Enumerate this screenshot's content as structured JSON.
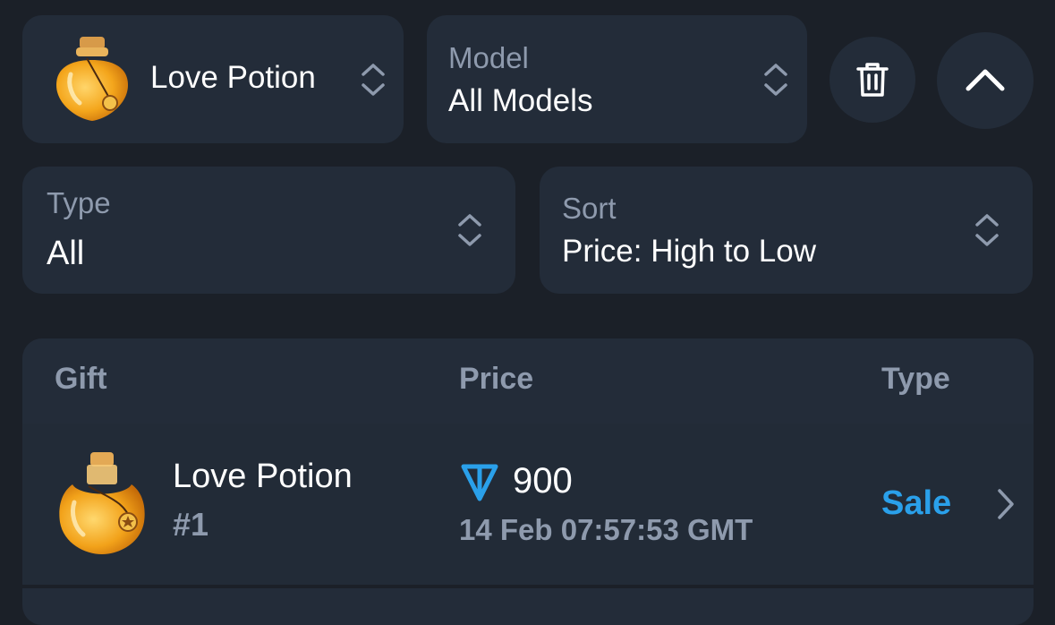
{
  "filters": {
    "gift": {
      "value": "Love Potion",
      "icon": "love-potion-icon"
    },
    "model": {
      "label": "Model",
      "value": "All Models"
    },
    "type": {
      "label": "Type",
      "value": "All"
    },
    "sort": {
      "label": "Sort",
      "value": "Price: High to Low"
    },
    "trash_icon": "trash-icon",
    "collapse_icon": "chevron-up-icon"
  },
  "table": {
    "headers": {
      "gift": "Gift",
      "price": "Price",
      "type": "Type"
    },
    "rows": [
      {
        "name": "Love Potion",
        "number": "#1",
        "price": "900",
        "currency_icon": "ton-icon",
        "date": "14 Feb 07:57:53 GMT",
        "type": "Sale"
      }
    ]
  },
  "colors": {
    "background": "#1b2028",
    "card": "#232c39",
    "muted_text": "#8e9aad",
    "accent": "#2aa0ea"
  }
}
